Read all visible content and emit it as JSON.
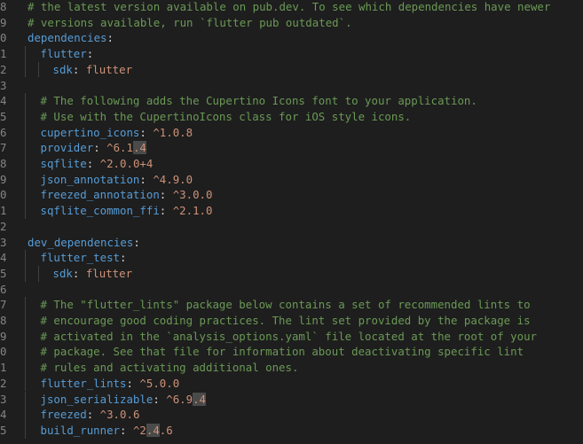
{
  "editor": {
    "theme": "dark",
    "colors": {
      "background": "#1e1e1e",
      "key": "#569cd6",
      "value": "#ce9178",
      "comment": "#6a9955",
      "punctuation": "#d4d4d4",
      "line_number": "#858585",
      "selection_highlight": "#4a4a4a"
    },
    "current_line": 32,
    "lines": [
      {
        "n": "8",
        "indent": 1,
        "tokens": [
          {
            "t": "c",
            "v": "# the latest version available on pub.dev. To see which dependencies have newer"
          }
        ]
      },
      {
        "n": "9",
        "indent": 1,
        "tokens": [
          {
            "t": "c",
            "v": "# versions available, run `flutter pub outdated`."
          }
        ]
      },
      {
        "n": "0",
        "indent": 1,
        "tokens": [
          {
            "t": "k",
            "v": "dependencies"
          },
          {
            "t": "p",
            "v": ":"
          }
        ]
      },
      {
        "n": "1",
        "indent": 2,
        "tokens": [
          {
            "t": "k",
            "v": "flutter"
          },
          {
            "t": "p",
            "v": ":"
          }
        ]
      },
      {
        "n": "2",
        "indent": 3,
        "tokens": [
          {
            "t": "k",
            "v": "sdk"
          },
          {
            "t": "p",
            "v": ": "
          },
          {
            "t": "s",
            "v": "flutter"
          }
        ]
      },
      {
        "n": "3",
        "indent": 0,
        "tokens": []
      },
      {
        "n": "4",
        "indent": 2,
        "tokens": [
          {
            "t": "c",
            "v": "# The following adds the Cupertino Icons font to your application."
          }
        ]
      },
      {
        "n": "5",
        "indent": 2,
        "tokens": [
          {
            "t": "c",
            "v": "# Use with the CupertinoIcons class for iOS style icons."
          }
        ]
      },
      {
        "n": "6",
        "indent": 2,
        "tokens": [
          {
            "t": "k",
            "v": "cupertino_icons"
          },
          {
            "t": "p",
            "v": ": "
          },
          {
            "t": "s",
            "v": "^1.0.8"
          }
        ]
      },
      {
        "n": "7",
        "indent": 2,
        "tokens": [
          {
            "t": "k",
            "v": "provider"
          },
          {
            "t": "p",
            "v": ": "
          },
          {
            "t": "s",
            "v": "^6.1"
          },
          {
            "t": "s",
            "v": ".4",
            "hl": true
          }
        ]
      },
      {
        "n": "8",
        "indent": 2,
        "tokens": [
          {
            "t": "k",
            "v": "sqflite"
          },
          {
            "t": "p",
            "v": ": "
          },
          {
            "t": "s",
            "v": "^2.0.0+4"
          }
        ]
      },
      {
        "n": "9",
        "indent": 2,
        "tokens": [
          {
            "t": "k",
            "v": "json_annotation"
          },
          {
            "t": "p",
            "v": ": "
          },
          {
            "t": "s",
            "v": "^4.9.0"
          }
        ]
      },
      {
        "n": "0",
        "indent": 2,
        "tokens": [
          {
            "t": "k",
            "v": "freezed_annotation"
          },
          {
            "t": "p",
            "v": ": "
          },
          {
            "t": "s",
            "v": "^3.0.0"
          }
        ]
      },
      {
        "n": "1",
        "indent": 2,
        "tokens": [
          {
            "t": "k",
            "v": "sqflite_common_ffi"
          },
          {
            "t": "p",
            "v": ": "
          },
          {
            "t": "s",
            "v": "^2.1.0"
          }
        ]
      },
      {
        "n": "2",
        "indent": 0,
        "tokens": []
      },
      {
        "n": "3",
        "indent": 1,
        "tokens": [
          {
            "t": "k",
            "v": "dev_dependencies"
          },
          {
            "t": "p",
            "v": ":"
          }
        ]
      },
      {
        "n": "4",
        "indent": 2,
        "tokens": [
          {
            "t": "k",
            "v": "flutter_test"
          },
          {
            "t": "p",
            "v": ":"
          }
        ]
      },
      {
        "n": "5",
        "indent": 3,
        "tokens": [
          {
            "t": "k",
            "v": "sdk"
          },
          {
            "t": "p",
            "v": ": "
          },
          {
            "t": "s",
            "v": "flutter"
          }
        ]
      },
      {
        "n": "6",
        "indent": 0,
        "tokens": []
      },
      {
        "n": "7",
        "indent": 2,
        "tokens": [
          {
            "t": "c",
            "v": "# The \"flutter_lints\" package below contains a set of recommended lints to"
          }
        ]
      },
      {
        "n": "8",
        "indent": 2,
        "tokens": [
          {
            "t": "c",
            "v": "# encourage good coding practices. The lint set provided by the package is"
          }
        ]
      },
      {
        "n": "9",
        "indent": 2,
        "tokens": [
          {
            "t": "c",
            "v": "# activated in the `analysis_options.yaml` file located at the root of your"
          }
        ]
      },
      {
        "n": "0",
        "indent": 2,
        "tokens": [
          {
            "t": "c",
            "v": "# package. See that file for information about deactivating specific lint"
          }
        ]
      },
      {
        "n": "1",
        "indent": 2,
        "tokens": [
          {
            "t": "c",
            "v": "# rules and activating additional ones."
          }
        ]
      },
      {
        "n": "2",
        "indent": 2,
        "tokens": [
          {
            "t": "k",
            "v": "flutter_lints"
          },
          {
            "t": "p",
            "v": ": "
          },
          {
            "t": "s",
            "v": "^5.0.0"
          }
        ]
      },
      {
        "n": "3",
        "indent": 2,
        "tokens": [
          {
            "t": "k",
            "v": "json_serializable"
          },
          {
            "t": "p",
            "v": ": "
          },
          {
            "t": "s",
            "v": "^6.9"
          },
          {
            "t": "s",
            "v": ".4",
            "hl": true
          }
        ]
      },
      {
        "n": "4",
        "indent": 2,
        "tokens": [
          {
            "t": "k",
            "v": "freezed"
          },
          {
            "t": "p",
            "v": ": "
          },
          {
            "t": "s",
            "v": "^3.0.6"
          }
        ]
      },
      {
        "n": "5",
        "indent": 2,
        "tokens": [
          {
            "t": "k",
            "v": "build_runner"
          },
          {
            "t": "p",
            "v": ": "
          },
          {
            "t": "s",
            "v": "^2"
          },
          {
            "t": "s",
            "v": ".4",
            "hl": true
          },
          {
            "t": "s",
            "v": ".6"
          }
        ]
      }
    ]
  }
}
